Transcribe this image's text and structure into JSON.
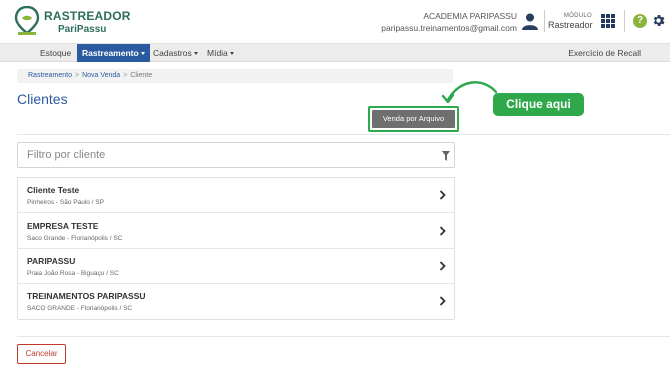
{
  "brand": {
    "title": "RASTREADOR",
    "subtitle": "PariPassu"
  },
  "account": {
    "company": "ACADEMIA PARIPASSU",
    "email": "paripassu.treinamentos@gmail.com"
  },
  "module": {
    "label": "MÓDULO",
    "value": "Rastreador"
  },
  "help_icon_glyph": "?",
  "nav": {
    "items": [
      {
        "label": "Estoque",
        "dropdown": false,
        "active": false
      },
      {
        "label": "Rastreamento",
        "dropdown": true,
        "active": true
      },
      {
        "label": "Cadastros",
        "dropdown": true,
        "active": false
      },
      {
        "label": "Mídia",
        "dropdown": true,
        "active": false
      }
    ],
    "right_item": "Exercício de Recall"
  },
  "breadcrumb": {
    "items": [
      "Rastreamento",
      "Nova Venda",
      "Cliente"
    ],
    "separator": ">"
  },
  "page": {
    "title": "Clientes",
    "venda_button": "Venda por Arquivo",
    "annotation": "Clique aqui"
  },
  "filter": {
    "placeholder": "Filtro por cliente",
    "value": ""
  },
  "clients": [
    {
      "name": "Cliente Teste",
      "address": "Pinheiros - São Paulo / SP"
    },
    {
      "name": "EMPRESA TESTE",
      "address": "Saco Grande - Florianópolis / SC"
    },
    {
      "name": "PARIPASSU",
      "address": "Praia João Rosa - Biguaçu / SC"
    },
    {
      "name": "TREINAMENTOS PARIPASSU",
      "address": "SACO GRANDE - Florianópolis / SC"
    }
  ],
  "cancel_button": "Cancelar",
  "colors": {
    "brand_green": "#2e6e5e",
    "nav_active": "#2b5aa0",
    "annotation_green": "#2ea84a",
    "cancel_red": "#c0392b"
  }
}
